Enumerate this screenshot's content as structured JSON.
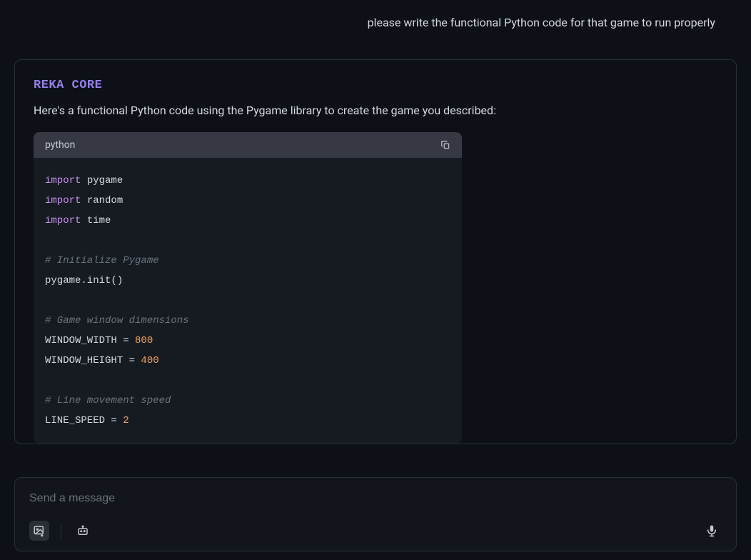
{
  "user_message": "please write the functional Python code for that game to run properly",
  "assistant": {
    "model_name": "REKA CORE",
    "intro_text": "Here's a functional Python code using the Pygame library to create the game you described:",
    "code": {
      "language": "python",
      "lines": [
        {
          "tokens": [
            {
              "t": "import",
              "c": "tok-keyword"
            },
            {
              "t": " pygame"
            }
          ]
        },
        {
          "tokens": [
            {
              "t": "import",
              "c": "tok-keyword"
            },
            {
              "t": " random"
            }
          ]
        },
        {
          "tokens": [
            {
              "t": "import",
              "c": "tok-keyword"
            },
            {
              "t": " time"
            }
          ]
        },
        {
          "tokens": []
        },
        {
          "tokens": [
            {
              "t": "# Initialize Pygame",
              "c": "tok-comment"
            }
          ]
        },
        {
          "tokens": [
            {
              "t": "pygame.init()"
            }
          ]
        },
        {
          "tokens": []
        },
        {
          "tokens": [
            {
              "t": "# Game window dimensions",
              "c": "tok-comment"
            }
          ]
        },
        {
          "tokens": [
            {
              "t": "WINDOW_WIDTH = "
            },
            {
              "t": "800",
              "c": "tok-number"
            }
          ]
        },
        {
          "tokens": [
            {
              "t": "WINDOW_HEIGHT = "
            },
            {
              "t": "400",
              "c": "tok-number"
            }
          ]
        },
        {
          "tokens": []
        },
        {
          "tokens": [
            {
              "t": "# Line movement speed",
              "c": "tok-comment"
            }
          ]
        },
        {
          "tokens": [
            {
              "t": "LINE_SPEED = "
            },
            {
              "t": "2",
              "c": "tok-number"
            }
          ]
        }
      ]
    }
  },
  "input": {
    "placeholder": "Send a message"
  }
}
